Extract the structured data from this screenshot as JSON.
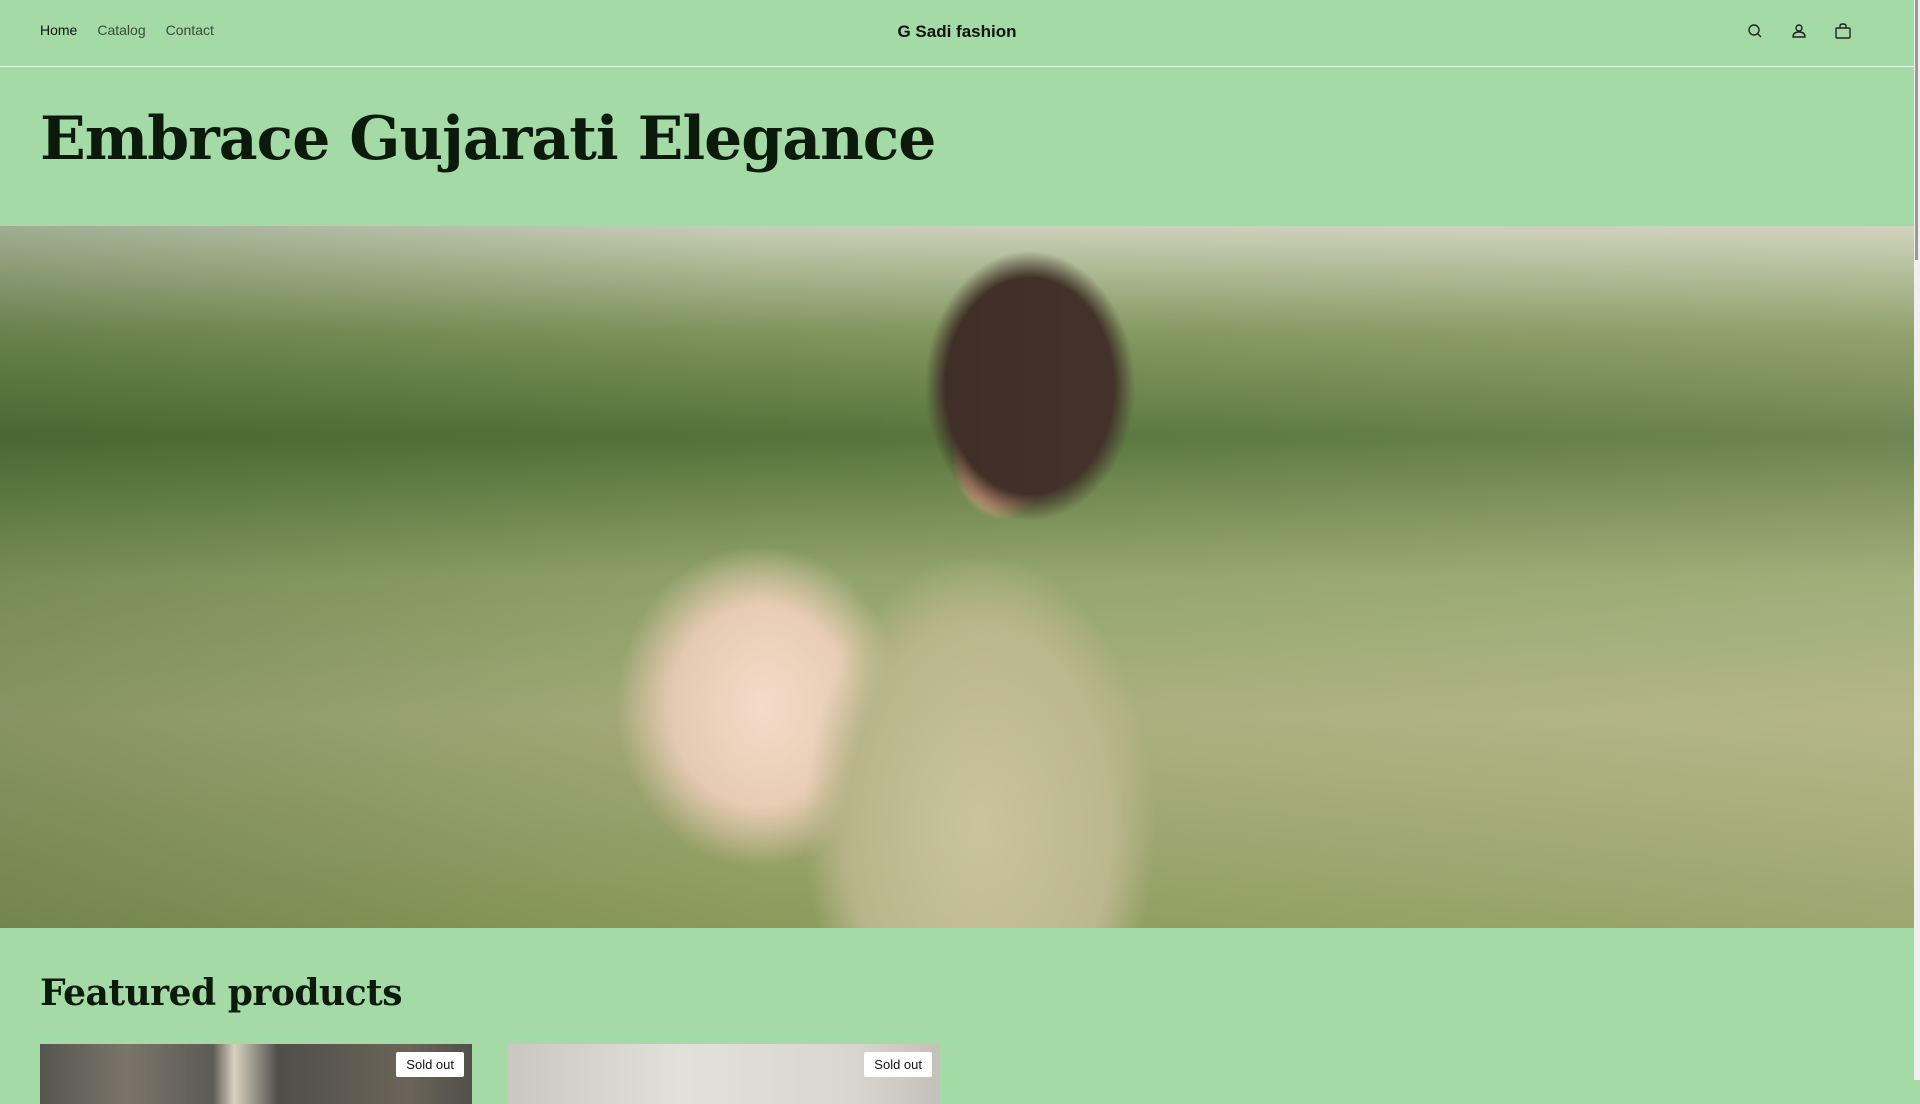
{
  "header": {
    "nav": [
      {
        "label": "Home",
        "active": true
      },
      {
        "label": "Catalog",
        "active": false
      },
      {
        "label": "Contact",
        "active": false
      }
    ],
    "brand": "G Sadi fashion",
    "icons": [
      "search-icon",
      "account-icon",
      "cart-icon"
    ]
  },
  "hero": {
    "title": "Embrace Gujarati Elegance"
  },
  "featured": {
    "heading": "Featured products",
    "products": [
      {
        "badge": "Sold out"
      },
      {
        "badge": "Sold out"
      }
    ]
  },
  "colors": {
    "background": "#a3daa6",
    "text": "#121212"
  }
}
